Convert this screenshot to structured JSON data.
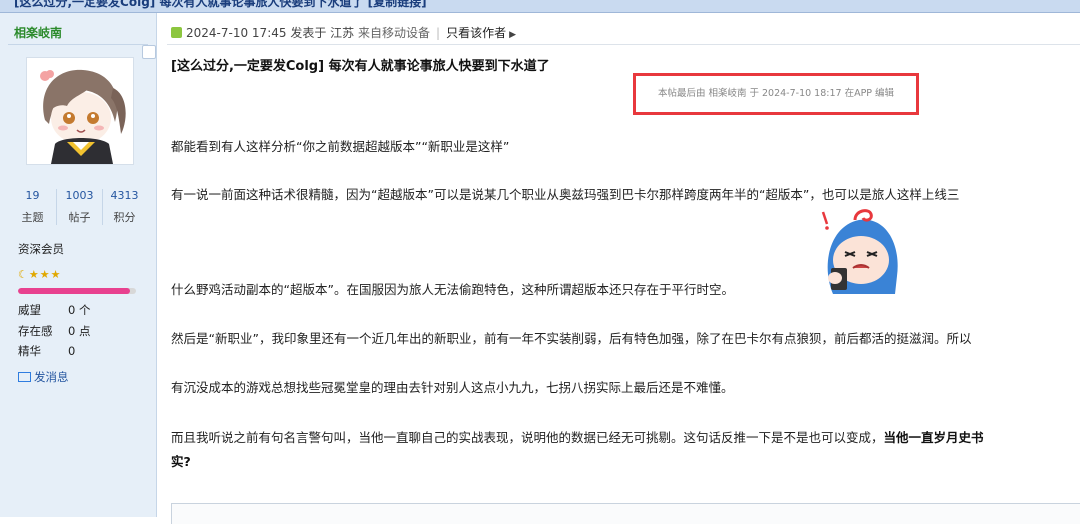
{
  "thread": {
    "title": "[这么过分,一定要发Colg] 每次有人就事论事旅人快要到下水道了 [复制链接]"
  },
  "sidebar": {
    "username": "相楽岐南",
    "stats": [
      {
        "value": "19",
        "label": "主题"
      },
      {
        "value": "1003",
        "label": "帖子"
      },
      {
        "value": "4313",
        "label": "积分"
      }
    ],
    "group": "资深会员",
    "stars": [
      "☾",
      "★",
      "★",
      "★"
    ],
    "progress": 0.95,
    "props": [
      {
        "key": "威望",
        "value": "0 个"
      },
      {
        "key": "存在感",
        "value": "0 点"
      },
      {
        "key": "精华",
        "value": "0"
      }
    ],
    "message": "发消息"
  },
  "post": {
    "posted": "2024-7-10 17:45",
    "posted_label": "发表于",
    "location": "江苏",
    "device": "来自移动设备",
    "only_author": "只看该作者",
    "title": "[这么过分,一定要发Colg] 每次有人就事论事旅人快要到下水道了",
    "edited": "本帖最后由 相楽岐南 于 2024-7-10 18:17 在APP 编辑",
    "paragraphs": [
      "都能看到有人这样分析“你之前数据超越版本”“新职业是这样”",
      "有一说一前面这种话术很精髓，因为“超越版本”可以是说某几个职业从奥兹玛强到巴卡尔那样跨度两年半的“超版本”，也可以是旅人这样上线三",
      "什么野鸡活动副本的“超版本”。在国服因为旅人无法偷跑特色，这种所谓超版本还只存在于平行时空。",
      "然后是“新职业”，我印象里还有一个近几年出的新职业，前有一年不实装削弱，后有特色加强，除了在巴卡尔有点狼狈，前后都活的挺滋润。所以",
      "有沉没成本的游戏总想找些冠冕堂皇的理由去针对别人这点小九九，七拐八拐实际上最后还是不难懂。"
    ],
    "last_paragraph": {
      "prefix": "而且我听说之前有句名言警句叫，当他一直聊自己的实战表现，说明他的数据已经无可挑剔。这句话反推一下是不是也可以变成，",
      "bold": "当他一直岁月史书",
      "bold_line2": "实?"
    }
  },
  "colors": {
    "edited_box": "#e8383d",
    "username": "#2b8a2b",
    "link": "#2556a0",
    "progress": "#e8418f",
    "sidebar_bg": "#e6eff8"
  }
}
